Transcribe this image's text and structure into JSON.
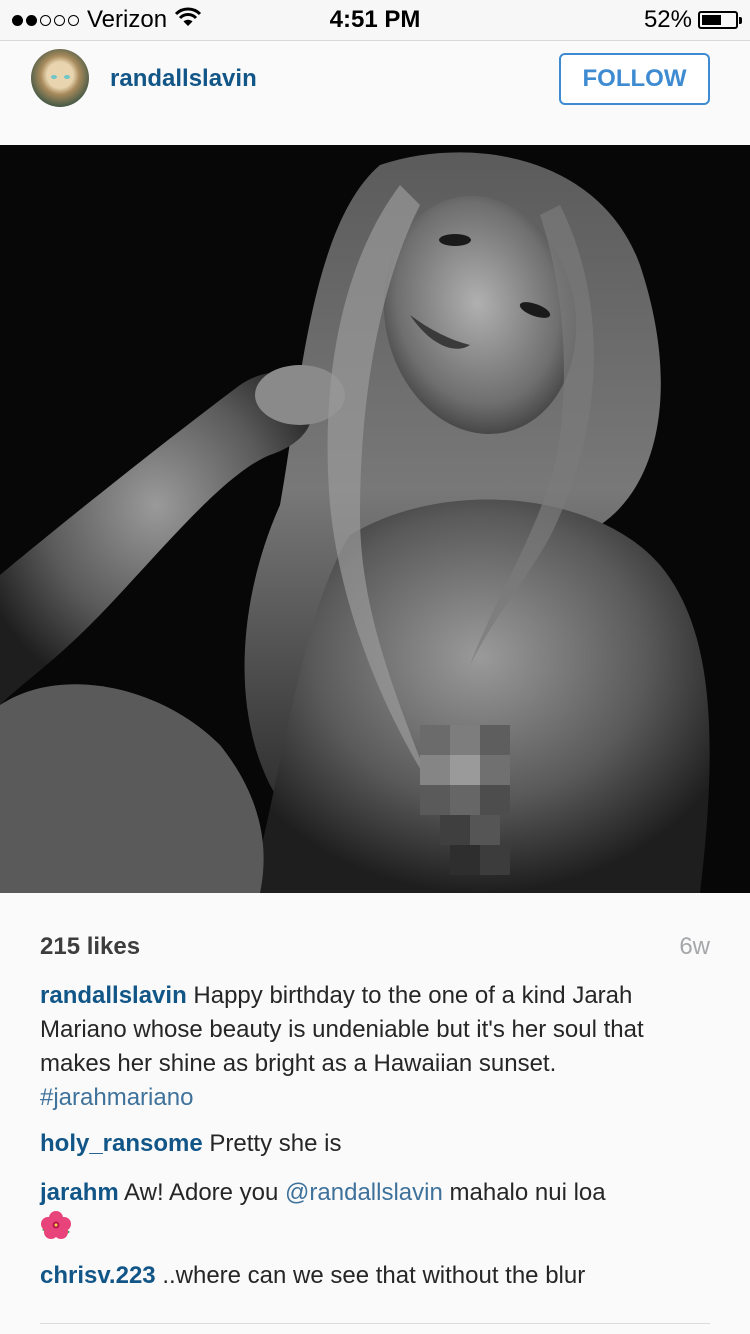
{
  "status_bar": {
    "carrier": "Verizon",
    "signal_strength": 2,
    "signal_max": 5,
    "time": "4:51 PM",
    "battery_percent": "52%",
    "battery_level": 0.52
  },
  "header": {
    "username": "randallslavin",
    "follow_label": "FOLLOW",
    "accent_color": "#3f8bd2",
    "username_color": "#125688"
  },
  "post": {
    "likes": "215 likes",
    "time_ago": "6w",
    "caption": {
      "user": "randallslavin",
      "text": "Happy birthday to the one of a kind Jarah Mariano whose beauty is undeniable but it's her soul that makes her shine as bright as a Hawaiian sunset.",
      "hashtag": "#jarahmariano"
    },
    "comments": [
      {
        "user": "holy_ransome",
        "text": "Pretty she is"
      },
      {
        "user": "jarahm",
        "text_before": "Aw! Adore you",
        "mention": "@randallslavin",
        "text_after": "mahalo nui loa",
        "emoji": "hibiscus-icon"
      },
      {
        "user": "chrisv.223",
        "text": "..where can we see that without the blur"
      }
    ]
  }
}
